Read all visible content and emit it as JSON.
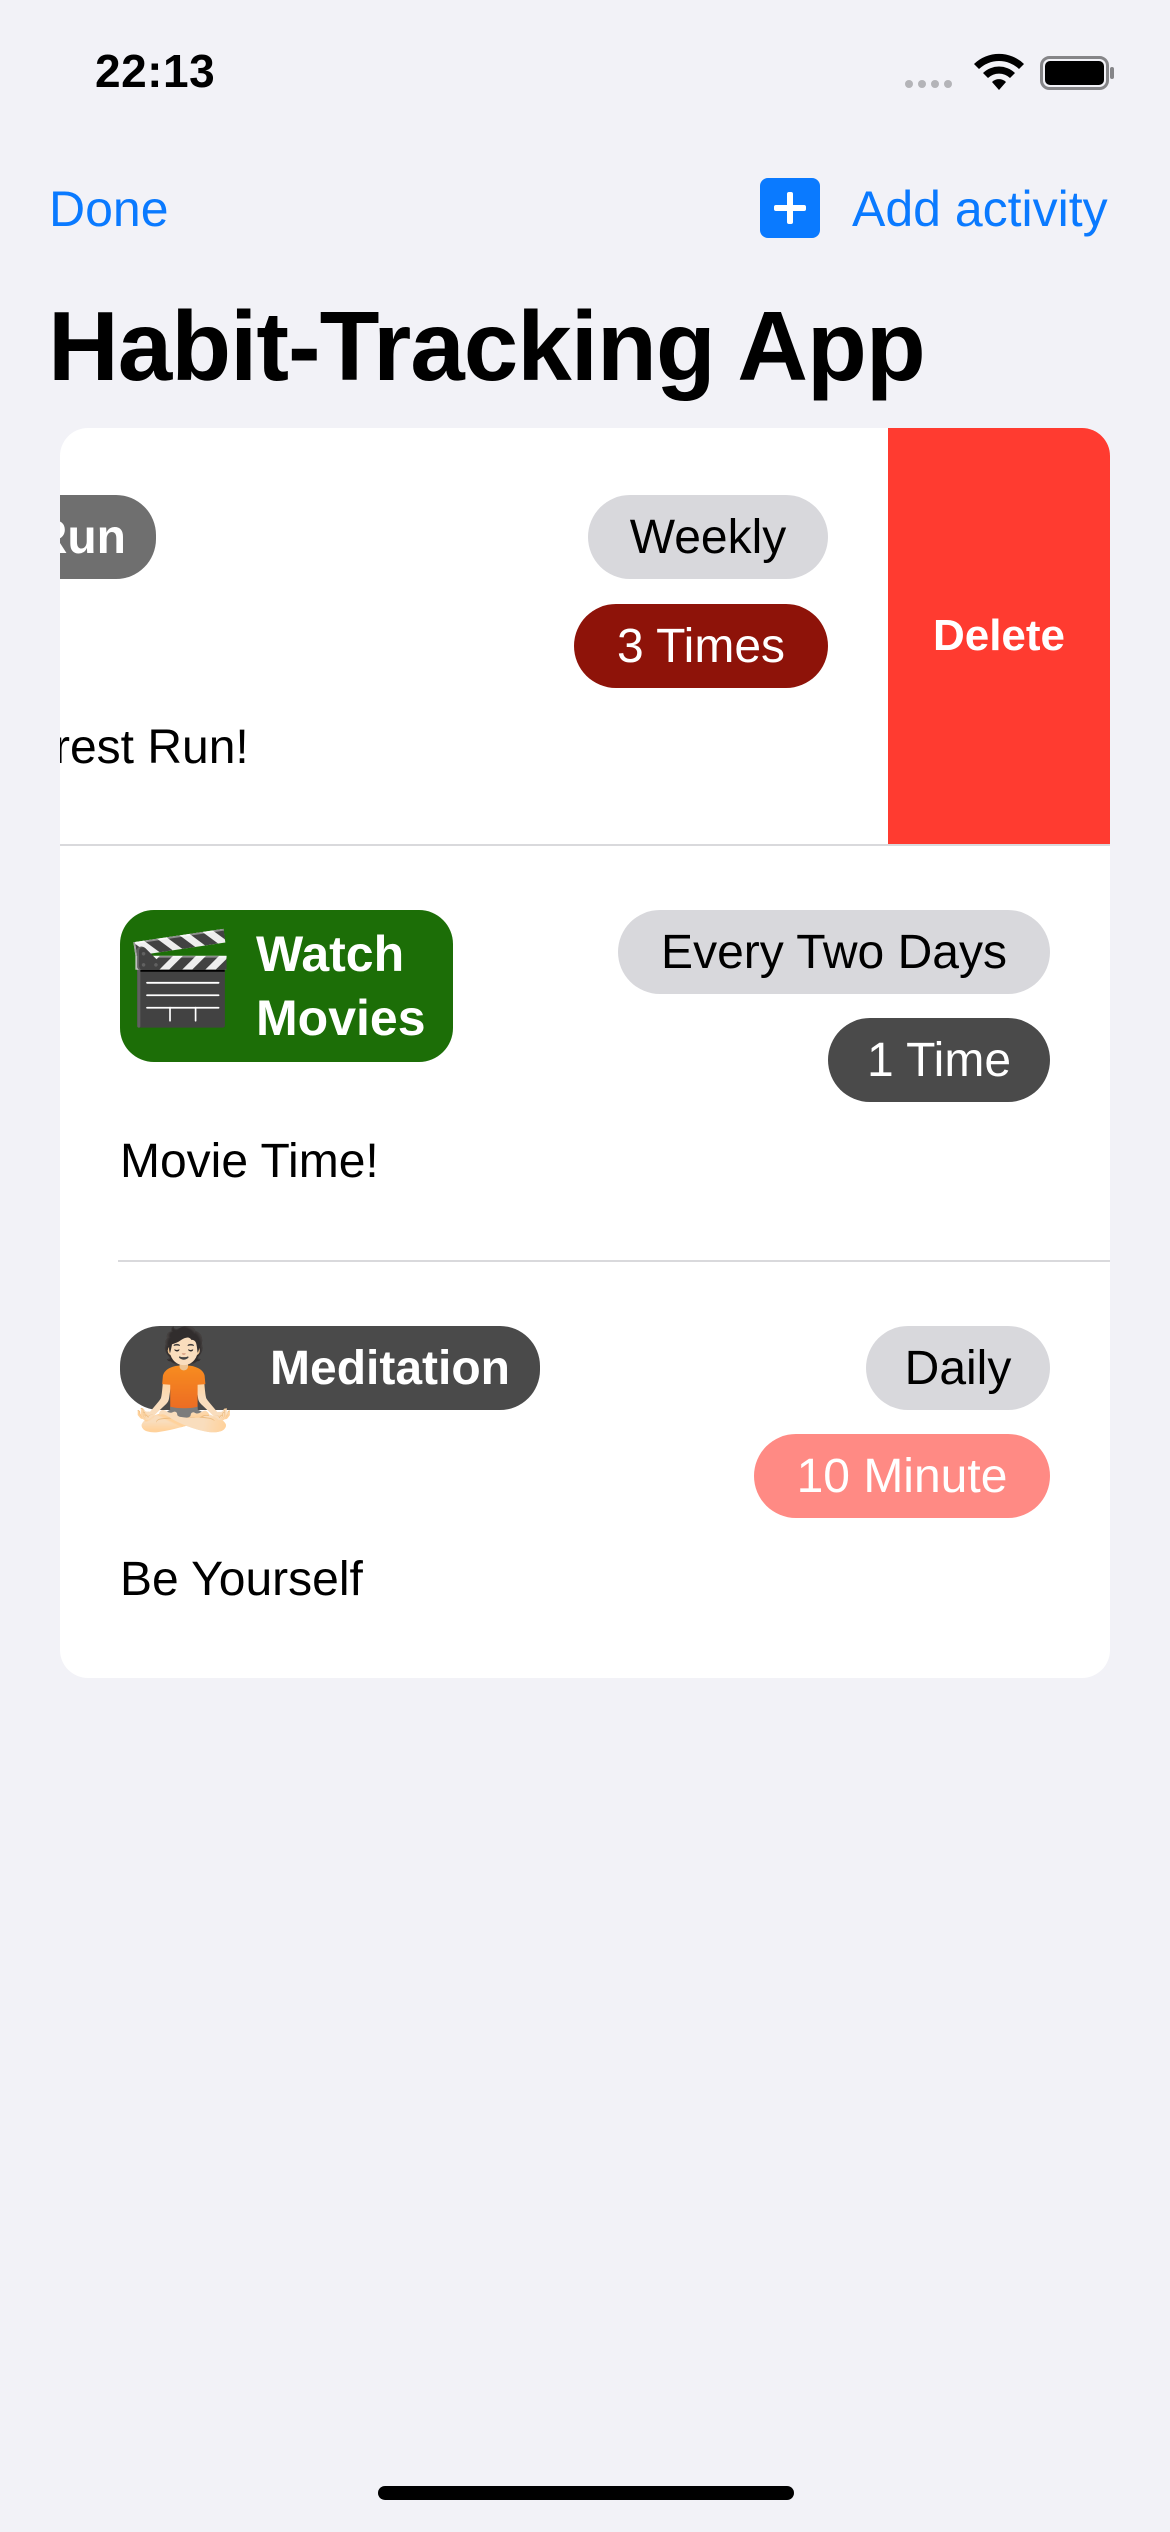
{
  "status_bar": {
    "time": "22:13"
  },
  "nav": {
    "done_label": "Done",
    "add_label": "Add activity"
  },
  "page_title": "Habit-Tracking App",
  "rows": [
    {
      "activity_label": "Run",
      "frequency": "Weekly",
      "amount": "3 Times",
      "note": "rest Run!",
      "delete_label": "Delete",
      "colors": {
        "activity": "#6f6f6f",
        "amount": "#8e1309"
      }
    },
    {
      "activity_label_line1": "Watch",
      "activity_label_line2": "Movies",
      "icon": "clapper-board-icon",
      "frequency": "Every Two Days",
      "amount": "1 Time",
      "note": "Movie Time!",
      "colors": {
        "activity": "#1c6e07",
        "amount": "#4a4a4a"
      }
    },
    {
      "activity_label": "Meditation",
      "icon": "meditation-person-icon",
      "frequency": "Daily",
      "amount": "10 Minute",
      "note": "Be Yourself",
      "colors": {
        "activity": "#4a4a4a",
        "amount": "#ff8a84"
      }
    }
  ],
  "colors": {
    "accent": "#0a7aff",
    "delete": "#ff3b30",
    "frequency_pill": "#d8d8dc"
  }
}
